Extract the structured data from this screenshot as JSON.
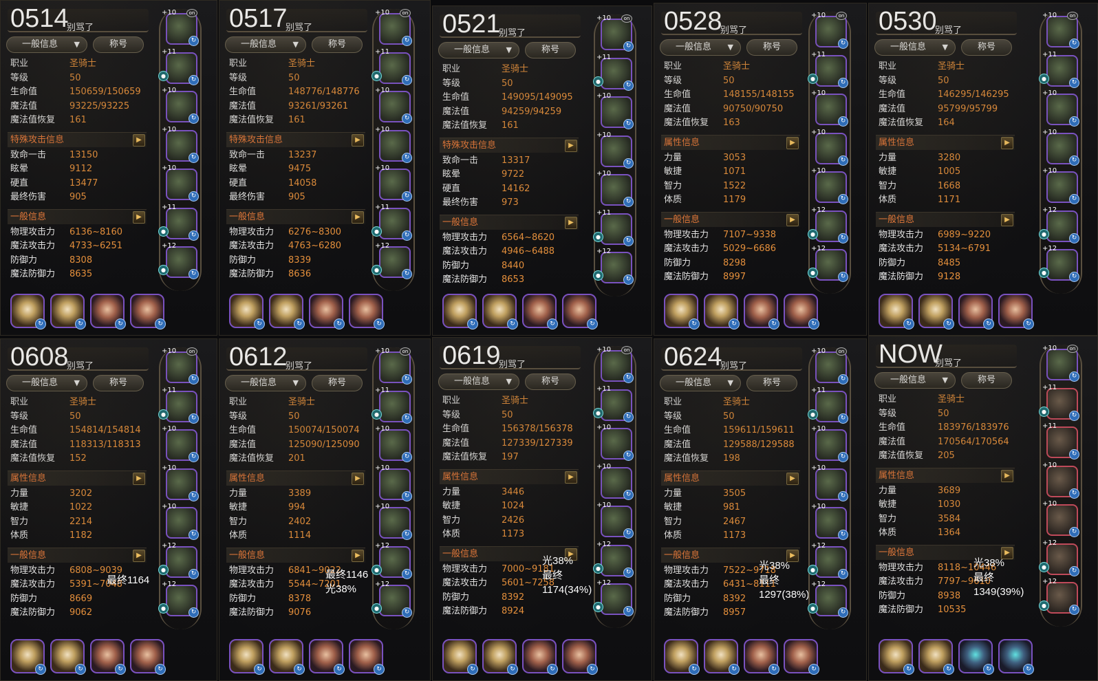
{
  "labels": {
    "nickname": "别骂了",
    "dropdown": "一般信息",
    "title_button": "称号",
    "job": "职业",
    "level": "等级",
    "hp": "生命值",
    "mp": "魔法值",
    "mp_regen": "魔法值恢复",
    "section_special": "特殊攻击信息",
    "section_attr": "属性信息",
    "section_general": "一般信息",
    "crit": "致命一击",
    "stun": "眩晕",
    "stiff": "硬直",
    "final_dmg": "最终伤害",
    "str": "力量",
    "agi": "敏捷",
    "int": "智力",
    "vit": "体质",
    "patk": "物理攻击力",
    "matk": "魔法攻击力",
    "def": "防御力",
    "mdef": "魔法防御力"
  },
  "icons": {
    "chevron": "chevron-down-icon",
    "arrow": "arrow-right-icon",
    "gear": "refresh-icon",
    "lock": "lock-icon"
  },
  "colors": {
    "value": "#e8913c",
    "section": "#e87a3a",
    "slot_border": "#7a52c0"
  },
  "panels": [
    {
      "date": "0514",
      "job": "圣骑士",
      "level": "50",
      "hp": "150659/150659",
      "mp": "93225/93225",
      "mp_regen": "161",
      "mode": "special",
      "crit": "13150",
      "stun": "9112",
      "stiff": "13477",
      "final_dmg": "905",
      "patk": "6136~8160",
      "matk": "4733~6251",
      "def": "8308",
      "mdef": "8635",
      "slots": [
        "+10",
        "+11",
        "+10",
        "+10",
        "+10",
        "+11",
        "+12"
      ],
      "annotation": []
    },
    {
      "date": "0517",
      "job": "圣骑士",
      "level": "50",
      "hp": "148776/148776",
      "mp": "93261/93261",
      "mp_regen": "161",
      "mode": "special",
      "crit": "13237",
      "stun": "9475",
      "stiff": "14058",
      "final_dmg": "905",
      "patk": "6276~8300",
      "matk": "4763~6280",
      "def": "8339",
      "mdef": "8636",
      "slots": [
        "+10",
        "+11",
        "+10",
        "+10",
        "+10",
        "+11",
        "+12"
      ],
      "annotation": []
    },
    {
      "date": "0521",
      "job": "圣骑士",
      "level": "50",
      "hp": "149095/149095",
      "mp": "94259/94259",
      "mp_regen": "161",
      "mode": "special",
      "crit": "13317",
      "stun": "9722",
      "stiff": "14162",
      "final_dmg": "973",
      "patk": "6564~8620",
      "matk": "4946~6488",
      "def": "8440",
      "mdef": "8653",
      "slots": [
        "+10",
        "+11",
        "+10",
        "+10",
        "+10",
        "+11",
        "+12"
      ],
      "annotation": []
    },
    {
      "date": "0528",
      "job": "圣骑士",
      "level": "50",
      "hp": "148155/148155",
      "mp": "90750/90750",
      "mp_regen": "163",
      "mode": "attr",
      "str": "3053",
      "agi": "1071",
      "int": "1522",
      "vit": "1179",
      "patk": "7107~9338",
      "matk": "5029~6686",
      "def": "8298",
      "mdef": "8997",
      "slots": [
        "+10",
        "+11",
        "+10",
        "+10",
        "+10",
        "+12",
        "+12"
      ],
      "annotation": []
    },
    {
      "date": "0530",
      "job": "圣骑士",
      "level": "50",
      "hp": "146295/146295",
      "mp": "95799/95799",
      "mp_regen": "164",
      "mode": "attr",
      "str": "3280",
      "agi": "1005",
      "int": "1668",
      "vit": "1171",
      "patk": "6989~9220",
      "matk": "5134~6791",
      "def": "8485",
      "mdef": "9128",
      "slots": [
        "+10",
        "+11",
        "+10",
        "+10",
        "+10",
        "+12",
        "+12"
      ],
      "annotation": []
    },
    {
      "date": "0608",
      "job": "圣骑士",
      "level": "50",
      "hp": "154814/154814",
      "mp": "118313/118313",
      "mp_regen": "152",
      "mode": "attr",
      "str": "3202",
      "agi": "1022",
      "int": "2214",
      "vit": "1182",
      "patk": "6808~9039",
      "matk": "5391~7048",
      "def": "8669",
      "mdef": "9062",
      "slots": [
        "+10",
        "+11",
        "+10",
        "+10",
        "+10",
        "+12",
        "+12"
      ],
      "annotation": [
        "最终1164"
      ]
    },
    {
      "date": "0612",
      "job": "圣骑士",
      "level": "50",
      "hp": "150074/150074",
      "mp": "125090/125090",
      "mp_regen": "201",
      "mode": "attr",
      "str": "3389",
      "agi": "994",
      "int": "2402",
      "vit": "1114",
      "patk": "6841~9022",
      "matk": "5544~7201",
      "def": "8378",
      "mdef": "9076",
      "slots": [
        "+10",
        "+11",
        "+10",
        "+10",
        "+10",
        "+12",
        "+12"
      ],
      "annotation": [
        "最终1146",
        "光38%"
      ]
    },
    {
      "date": "0619",
      "job": "圣骑士",
      "level": "50",
      "hp": "156378/156378",
      "mp": "127339/127339",
      "mp_regen": "197",
      "mode": "attr",
      "str": "3446",
      "agi": "1024",
      "int": "2426",
      "vit": "1173",
      "patk": "7000~9181",
      "matk": "5601~7258",
      "def": "8392",
      "mdef": "8924",
      "slots": [
        "+10",
        "+11",
        "+10",
        "+10",
        "+10",
        "+12",
        "+12"
      ],
      "annotation": [
        "光38%",
        "最终1174(34%)"
      ]
    },
    {
      "date": "0624",
      "job": "圣骑士",
      "level": "50",
      "hp": "159611/159611",
      "mp": "129588/129588",
      "mp_regen": "198",
      "mode": "attr",
      "str": "3505",
      "agi": "981",
      "int": "2467",
      "vit": "1173",
      "patk": "7522~9718",
      "matk": "6431~8111",
      "def": "8392",
      "mdef": "8957",
      "slots": [
        "+10",
        "+11",
        "+10",
        "+10",
        "+10",
        "+12",
        "+12"
      ],
      "annotation": [
        "光38%",
        "最终1297(38%)"
      ]
    },
    {
      "date": "NOW",
      "job": "圣骑士",
      "level": "50",
      "hp": "183976/183976",
      "mp": "170564/170564",
      "mp_regen": "205",
      "mode": "attr",
      "str": "3689",
      "agi": "1030",
      "int": "3584",
      "vit": "1364",
      "patk": "8118~10446",
      "matk": "7797~9610",
      "def": "8938",
      "mdef": "10535",
      "slots": [
        "+10",
        "+11",
        "+11",
        "+10",
        "+10",
        "+12",
        "+12"
      ],
      "annotation": [
        "光38%",
        "最终1349(39%)"
      ]
    }
  ]
}
